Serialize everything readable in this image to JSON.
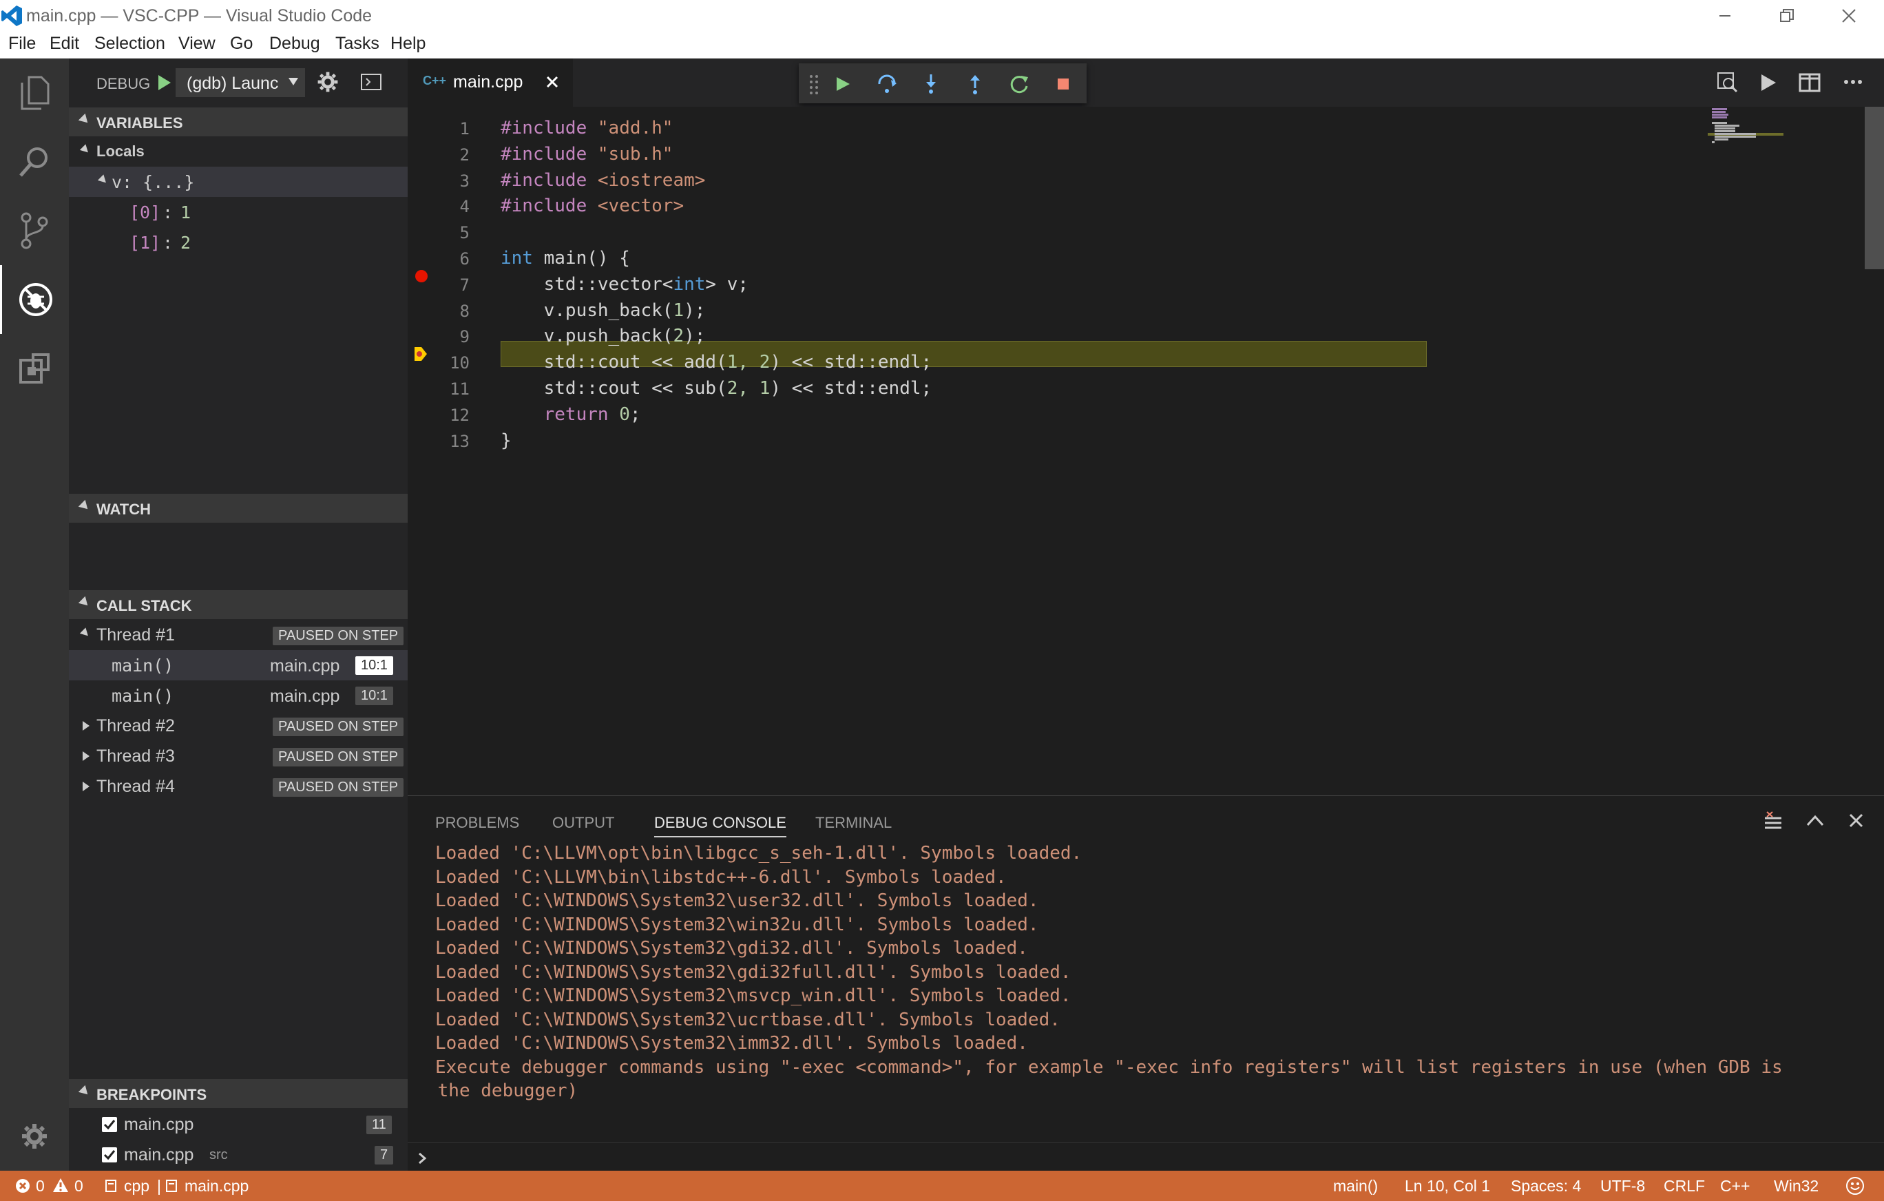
{
  "window": {
    "title": "main.cpp — VSC-CPP — Visual Studio Code"
  },
  "menu": [
    "File",
    "Edit",
    "Selection",
    "View",
    "Go",
    "Debug",
    "Tasks",
    "Help"
  ],
  "debug_bar": {
    "label": "DEBUG",
    "config": "(gdb) Launc"
  },
  "variables": {
    "header": "VARIABLES",
    "locals_label": "Locals",
    "var_name": "v: {...}",
    "items": [
      {
        "index": "[0]",
        "value": "1"
      },
      {
        "index": "[1]",
        "value": "2"
      }
    ]
  },
  "watch": {
    "header": "WATCH"
  },
  "call_stack": {
    "header": "CALL STACK",
    "threads": [
      {
        "name": "Thread #1",
        "status": "PAUSED ON STEP"
      },
      {
        "name": "Thread #2",
        "status": "PAUSED ON STEP"
      },
      {
        "name": "Thread #3",
        "status": "PAUSED ON STEP"
      },
      {
        "name": "Thread #4",
        "status": "PAUSED ON STEP"
      }
    ],
    "frames": [
      {
        "fn": "main()",
        "file": "main.cpp",
        "pos": "10:1"
      },
      {
        "fn": "main()",
        "file": "main.cpp",
        "pos": "10:1"
      }
    ]
  },
  "breakpoints": {
    "header": "BREAKPOINTS",
    "items": [
      {
        "file": "main.cpp",
        "dir": "",
        "line": "11"
      },
      {
        "file": "main.cpp",
        "dir": "src",
        "line": "7"
      }
    ]
  },
  "editor": {
    "tab_icon": "C++",
    "tab_label": "main.cpp",
    "line_numbers": [
      "1",
      "2",
      "3",
      "4",
      "5",
      "6",
      "7",
      "8",
      "9",
      "10",
      "11",
      "12",
      "13"
    ],
    "code": [
      {
        "a": "#include",
        "b": " \"add.h\""
      },
      {
        "a": "#include",
        "b": " \"sub.h\""
      },
      {
        "a": "#include",
        "b": " <iostream>"
      },
      {
        "a": "#include",
        "b": " <vector>"
      },
      {
        "a": "",
        "b": ""
      },
      {
        "a": "int",
        "b": " main() {"
      },
      {
        "a": "    std::vector<",
        "k": "int",
        "b": "> v;"
      },
      {
        "a": "    v.push_back(",
        "n": "1",
        "b": ");"
      },
      {
        "a": "    v.push_back(",
        "n": "2",
        "b": ");"
      },
      {
        "a": "    std::cout << add(",
        "n": "1, 2",
        "b": ") << std::endl;"
      },
      {
        "a": "    std::cout << sub(",
        "n": "2, 1",
        "b": ") << std::endl;"
      },
      {
        "a": "    return ",
        "n": "0",
        "b": ";"
      },
      {
        "a": "}",
        "b": ""
      }
    ],
    "breakpoint_line": 7,
    "current_line": 10
  },
  "panel": {
    "tabs": [
      "PROBLEMS",
      "OUTPUT",
      "DEBUG CONSOLE",
      "TERMINAL"
    ],
    "active_tab": "DEBUG CONSOLE",
    "lines": [
      "Loaded 'C:\\LLVM\\opt\\bin\\libgcc_s_seh-1.dll'. Symbols loaded.",
      "Loaded 'C:\\LLVM\\bin\\libstdc++-6.dll'. Symbols loaded.",
      "Loaded 'C:\\WINDOWS\\System32\\user32.dll'. Symbols loaded.",
      "Loaded 'C:\\WINDOWS\\System32\\win32u.dll'. Symbols loaded.",
      "Loaded 'C:\\WINDOWS\\System32\\gdi32.dll'. Symbols loaded.",
      "Loaded 'C:\\WINDOWS\\System32\\gdi32full.dll'. Symbols loaded.",
      "Loaded 'C:\\WINDOWS\\System32\\msvcp_win.dll'. Symbols loaded.",
      "Loaded 'C:\\WINDOWS\\System32\\ucrtbase.dll'. Symbols loaded.",
      "Loaded 'C:\\WINDOWS\\System32\\imm32.dll'. Symbols loaded.",
      "Execute debugger commands using \"-exec <command>\", for example \"-exec info registers\" will list registers in use (when GDB is",
      " the debugger)"
    ]
  },
  "status": {
    "errors": "0",
    "warnings": "0",
    "branch1": "cpp",
    "branch2": "main.cpp",
    "fn": "main()",
    "position": "Ln 10, Col 1",
    "spaces": "Spaces: 4",
    "encoding": "UTF-8",
    "eol": "CRLF",
    "language": "C++",
    "platform": "Win32"
  },
  "colors": {
    "status_bar": "#cc6633",
    "highlight": "#4b4b18",
    "breakpoint": "#e51400",
    "current_line_arrow": "#ffcc00"
  }
}
